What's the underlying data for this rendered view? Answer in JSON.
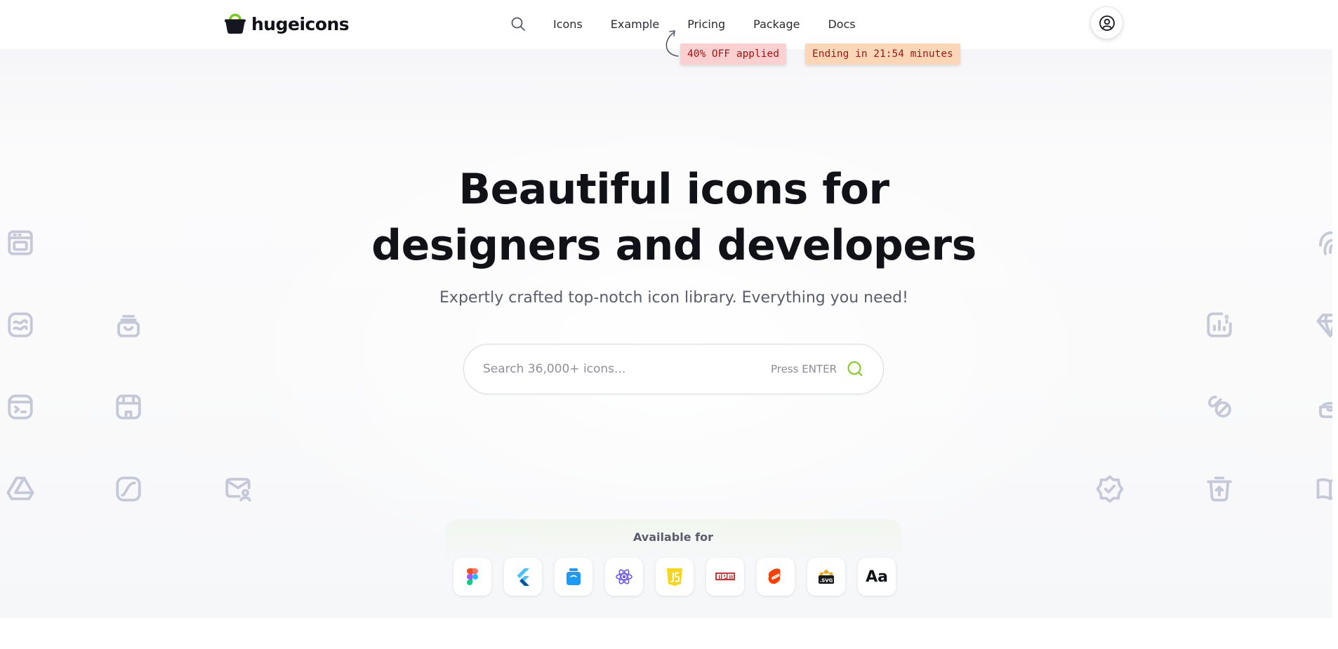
{
  "brand": {
    "name": "hugeicons",
    "icon": "basket-logo-icon",
    "accent": "#7ccc1b"
  },
  "nav": {
    "search_icon": "search-icon",
    "items": [
      "Icons",
      "Example",
      "Pricing",
      "Package",
      "Docs"
    ],
    "account_icon": "user-circle-icon"
  },
  "promo": {
    "discount": "40% OFF applied",
    "timer": "Ending in 21:54 minutes",
    "discount_bg": "#fbd0d0",
    "timer_bg": "#fbd7b8"
  },
  "hero": {
    "title_line1": "Beautiful icons for",
    "title_line2": "designers and developers",
    "subtitle": "Expertly crafted top-notch icon library. Everything you need!"
  },
  "search": {
    "placeholder": "Search 36,000+ icons...",
    "hint": "Press ENTER",
    "icon": "search-icon",
    "icon_color": "#7ccc1b"
  },
  "available": {
    "title": "Available for",
    "platforms": [
      {
        "name": "Figma",
        "icon": "figma-icon"
      },
      {
        "name": "Flutter",
        "icon": "flutter-icon"
      },
      {
        "name": "Iconjar",
        "icon": "iconjar-icon"
      },
      {
        "name": "React",
        "icon": "react-icon"
      },
      {
        "name": "JavaScript",
        "icon": "js-icon"
      },
      {
        "name": "npm",
        "icon": "npm-icon"
      },
      {
        "name": "Svelte",
        "icon": "svelte-icon"
      },
      {
        "name": "SVG",
        "icon": "svg-icon"
      },
      {
        "name": "Font",
        "label": "Aa",
        "icon": "font-icon"
      }
    ]
  }
}
